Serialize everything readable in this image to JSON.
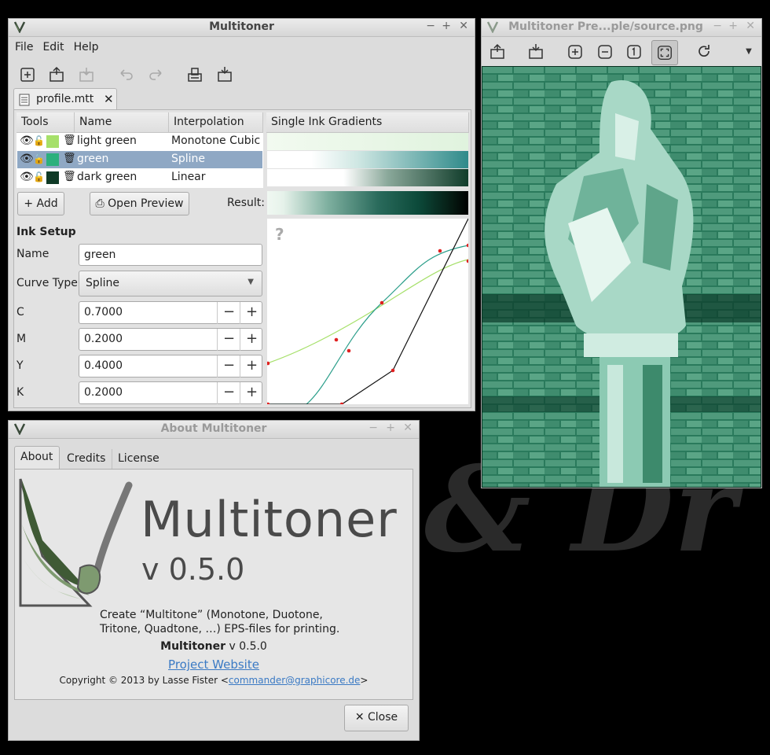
{
  "main_window": {
    "title": "Multitoner",
    "menu": [
      "File",
      "Edit",
      "Help"
    ],
    "tab_label": "profile.mtt",
    "table": {
      "headers": [
        "Tools",
        "Name",
        "Interpolation",
        "Single Ink Gradients"
      ],
      "rows": [
        {
          "name": "light green",
          "interpolation": "Monotone Cubic",
          "swatch": "#a6e06a"
        },
        {
          "name": "green",
          "interpolation": "Spline",
          "swatch": "#2bb07c"
        },
        {
          "name": "dark green",
          "interpolation": "Linear",
          "swatch": "#0f3a26"
        }
      ]
    },
    "add_label": "Add",
    "open_preview_label": "Open Preview",
    "result_label": "Result:",
    "ink_setup": {
      "title": "Ink Setup",
      "name_label": "Name",
      "name_value": "green",
      "curve_type_label": "Curve Type",
      "curve_type_value": "Spline",
      "c_label": "C",
      "c_value": "0.7000",
      "m_label": "M",
      "m_value": "0.2000",
      "y_label": "Y",
      "y_value": "0.4000",
      "k_label": "K",
      "k_value": "0.2000"
    },
    "curve_help": "?"
  },
  "preview_window": {
    "title": "Multitoner Pre...ple/source.png"
  },
  "about_window": {
    "title": "About Multitoner",
    "tabs": [
      "About",
      "Credits",
      "License"
    ],
    "app_name": "Multitoner",
    "version_big": "v 0.5.0",
    "description_line1": "Create “Multitone” (Monotone, Duotone,",
    "description_line2": "Tritone, Quadtone, …) EPS-files for printing.",
    "name_version_bold": "Multitoner",
    "name_version_rest": " v 0.5.0",
    "website_label": "Project Website",
    "copyright_prefix": "Copyright © 2013 by Lasse Fister <",
    "email": "commander@graphicore.de",
    "copyright_suffix": ">",
    "close_label": "Close"
  }
}
